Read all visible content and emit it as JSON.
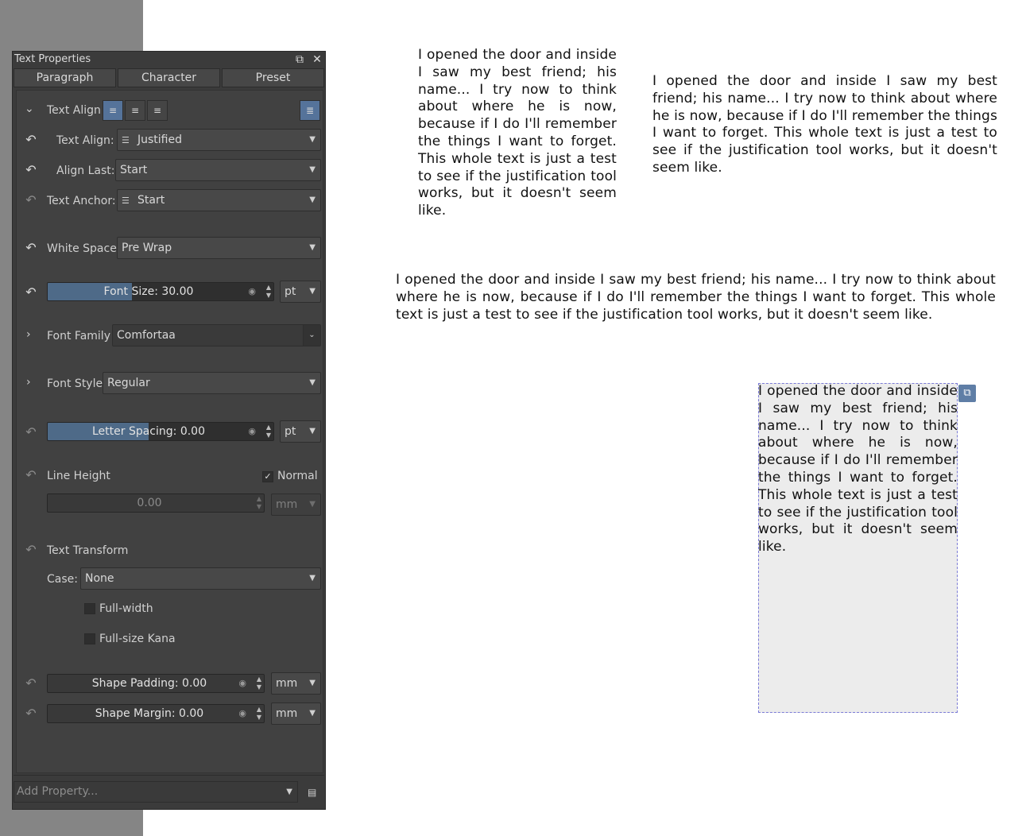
{
  "docker": {
    "title": "Text Properties",
    "float_icon": "float-icon",
    "close_icon": "close-icon",
    "tabs": [
      "Paragraph",
      "Character",
      "Preset"
    ]
  },
  "props": {
    "text_align_header": "Text Align",
    "text_align_label": "Text Align:",
    "text_align_value": "Justified",
    "align_last_label": "Align Last:",
    "align_last_value": "Start",
    "text_anchor_label": "Text Anchor:",
    "text_anchor_value": "Start",
    "white_space_label": "White Space",
    "white_space_value": "Pre Wrap",
    "font_size": "Font Size: 30.00",
    "font_size_unit": "pt",
    "font_family_label": "Font Family",
    "font_family_value": "Comfortaa",
    "font_style_label": "Font Style",
    "font_style_value": "Regular",
    "letter_spacing": "Letter Spacing: 0.00",
    "letter_spacing_unit": "pt",
    "line_height_label": "Line Height",
    "line_height_normal": "Normal",
    "line_height_value": "0.00",
    "line_height_unit": "mm",
    "text_transform_label": "Text Transform",
    "case_label": "Case:",
    "case_value": "None",
    "full_width_label": "Full-width",
    "full_size_kana_label": "Full-size Kana",
    "shape_padding": "Shape Padding: 0.00",
    "shape_padding_unit": "mm",
    "shape_margin": "Shape Margin: 0.00",
    "shape_margin_unit": "mm"
  },
  "footer": {
    "add_property_placeholder": "Add Property..."
  },
  "canvas": {
    "paragraph": "I opened the door and inside I saw my best friend; his name... I try now to think about where he is now, because if I do I'll remember the things I want to forget. This whole text is just a test to see if the justification tool works, but it doesn't seem like."
  }
}
